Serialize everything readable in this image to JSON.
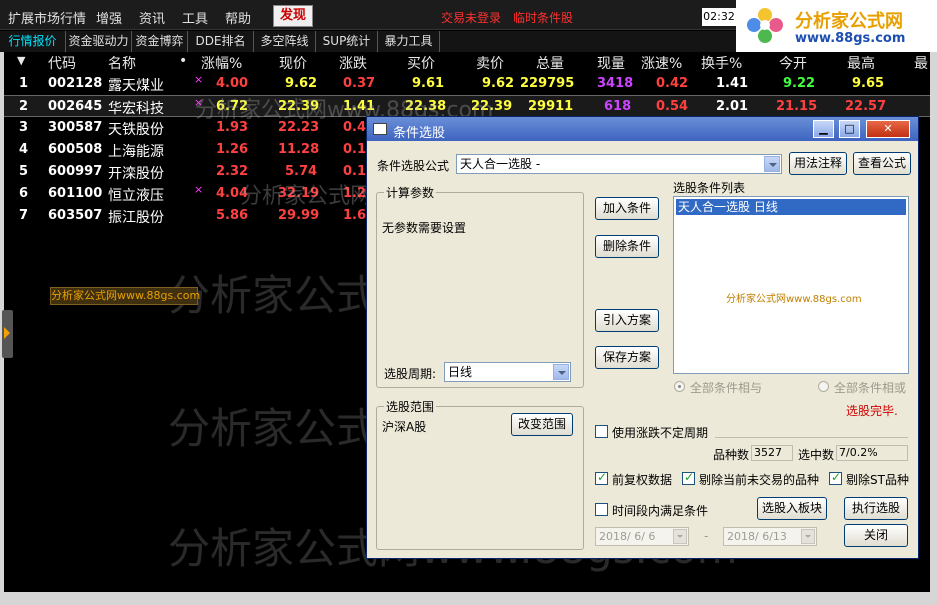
{
  "menubar": {
    "items": [
      "扩展市场行情",
      "增强",
      "资讯",
      "工具",
      "帮助"
    ],
    "discover": "发现",
    "status_login": "交易未登录",
    "status_screen": "临时条件股",
    "clock": "02:32"
  },
  "logo": {
    "name": "分析家公式网",
    "url": "www.88gs.com"
  },
  "tabs": [
    "行情报价",
    "资金驱动力",
    "资金博弈",
    "DDE排名",
    "多空阵线",
    "SUP统计",
    "暴力工具"
  ],
  "table": {
    "headers": [
      "代码",
      "名称",
      "•",
      "涨幅%",
      "现价",
      "涨跌",
      "买价",
      "卖价",
      "总量",
      "现量",
      "涨速%",
      "换手%",
      "今开",
      "最高",
      "最"
    ],
    "rows": [
      {
        "idx": "1",
        "code": "002128",
        "name": "露天煤业",
        "mark": "×",
        "chg_pct": "4.00",
        "price": "9.62",
        "chg": "0.37",
        "bid": "9.61",
        "ask": "9.62",
        "vol": "229795",
        "cur_vol": "3418",
        "speed": "0.42",
        "turnover": "1.41",
        "open": "9.22",
        "high": "9.65"
      },
      {
        "idx": "2",
        "code": "002645",
        "name": "华宏科技",
        "mark": "×",
        "chg_pct": "6.72",
        "price": "22.39",
        "chg": "1.41",
        "bid": "22.38",
        "ask": "22.39",
        "vol": "29911",
        "cur_vol": "618",
        "speed": "0.54",
        "turnover": "2.01",
        "open": "21.15",
        "high": "22.57"
      },
      {
        "idx": "3",
        "code": "300587",
        "name": "天铁股份",
        "mark": "",
        "chg_pct": "1.93",
        "price": "22.23",
        "chg": "0.4"
      },
      {
        "idx": "4",
        "code": "600508",
        "name": "上海能源",
        "mark": "",
        "chg_pct": "1.26",
        "price": "11.28",
        "chg": "0.1"
      },
      {
        "idx": "5",
        "code": "600997",
        "name": "开滦股份",
        "mark": "",
        "chg_pct": "2.32",
        "price": "5.74",
        "chg": "0.1"
      },
      {
        "idx": "6",
        "code": "601100",
        "name": "恒立液压",
        "mark": "×",
        "chg_pct": "4.04",
        "price": "32.19",
        "chg": "1.2"
      },
      {
        "idx": "7",
        "code": "603507",
        "name": "振江股份",
        "mark": "",
        "chg_pct": "5.86",
        "price": "29.99",
        "chg": "1.6"
      }
    ]
  },
  "watermark": {
    "big": "分析家公式网www.88gs.com",
    "box": "分析家公式网www.88gs.com"
  },
  "dialog": {
    "title": "条件选股",
    "formula_label": "条件选股公式",
    "formula_value": "天人合一选股 -",
    "usage_button": "用法注释",
    "view_button": "查看公式",
    "params_group": "计算参数",
    "params_text": "无参数需要设置",
    "period_label": "选股周期:",
    "period_value": "日线",
    "add_button": "加入条件",
    "delete_button": "删除条件",
    "import_button": "引入方案",
    "save_button": "保存方案",
    "list_label": "选股条件列表",
    "list_items": [
      "天人合一选股  日线"
    ],
    "list_watermark": "分析家公式网www.88gs.com",
    "radio_and": "全部条件相与",
    "radio_or": "全部条件相或",
    "status": "选股完毕.",
    "range_group": "选股范围",
    "range_value": "沪深A股",
    "range_button": "改变范围",
    "uncertain_period": "使用涨跌不定周期",
    "count_label": "品种数",
    "count_value": "3527",
    "selected_label": "选中数",
    "selected_value": "7/0.2%",
    "cb_prior": "前复权数据",
    "cb_exclude_untraded": "剔除当前未交易的品种",
    "cb_exclude_st": "剔除ST品种",
    "cb_timerange": "时间段内满足条件",
    "to_block_button": "选股入板块",
    "run_button": "执行选股",
    "date_from": "2018/ 6/ 6",
    "date_sep": "-",
    "date_to": "2018/ 6/13",
    "close_button": "关闭"
  },
  "colors": {
    "up": "#ff4040",
    "flat": "#ffffff",
    "highlight": "#ffff40",
    "volume": "#cc44ff",
    "open_green": "#40ff40",
    "accent_tab": "#00e5ff"
  }
}
